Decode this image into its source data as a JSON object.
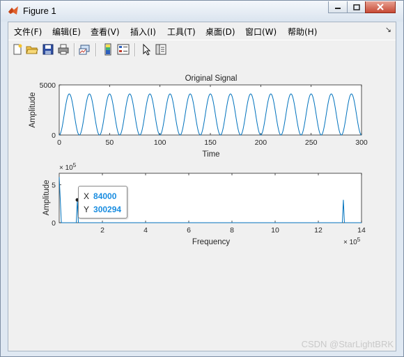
{
  "window": {
    "title": "Figure 1"
  },
  "menu": {
    "items": [
      "文件(F)",
      "编辑(E)",
      "查看(V)",
      "插入(I)",
      "工具(T)",
      "桌面(D)",
      "窗口(W)",
      "帮助(H)"
    ],
    "overflow": "↘"
  },
  "toolbar": {
    "buttons": [
      "new-figure-icon",
      "open-icon",
      "save-icon",
      "print-icon",
      "link-plot-icon",
      "insert-colorbar-icon",
      "insert-legend-icon",
      "pointer-icon",
      "property-editor-icon"
    ]
  },
  "plot1": {
    "title": "Original Signal",
    "xlabel": "Time",
    "ylabel": "Amplitude",
    "xticks": [
      "0",
      "50",
      "100",
      "150",
      "200",
      "250",
      "300"
    ],
    "yticks": [
      "0",
      "5000"
    ]
  },
  "plot2": {
    "xlabel": "Frequency",
    "ylabel": "Amplitude",
    "xticks": [
      "2",
      "4",
      "6",
      "8",
      "10",
      "12",
      "14"
    ],
    "yticks": [
      "0",
      "5"
    ],
    "yexp": "× 10",
    "yexp_power": "5",
    "xexp": "× 10",
    "xexp_power": "5"
  },
  "datatip": {
    "x_label": "X",
    "x_value": "84000",
    "y_label": "Y",
    "y_value": "300294"
  },
  "watermark": "CSDN @StarLightBRK",
  "colors": {
    "line": "#0072bd",
    "accent": "#1a8de0"
  },
  "chart_data": [
    {
      "type": "line",
      "title": "Original Signal",
      "xlabel": "Time",
      "ylabel": "Amplitude",
      "xlim": [
        0,
        300
      ],
      "ylim": [
        0,
        5000
      ],
      "series": [
        {
          "kind": "sinusoid",
          "offset": 2050,
          "amplitude": 2050,
          "period": 20,
          "phase_at_zero": "minimum"
        }
      ]
    },
    {
      "type": "line",
      "xlabel": "Frequency",
      "ylabel": "Amplitude",
      "xlim": [
        0,
        1400000
      ],
      "ylim": [
        0,
        650000
      ],
      "series": [
        {
          "points": [
            [
              0,
              600000
            ],
            [
              10000,
              0
            ],
            [
              84000,
              300294
            ],
            [
              1316000,
              300294
            ]
          ]
        }
      ]
    }
  ]
}
